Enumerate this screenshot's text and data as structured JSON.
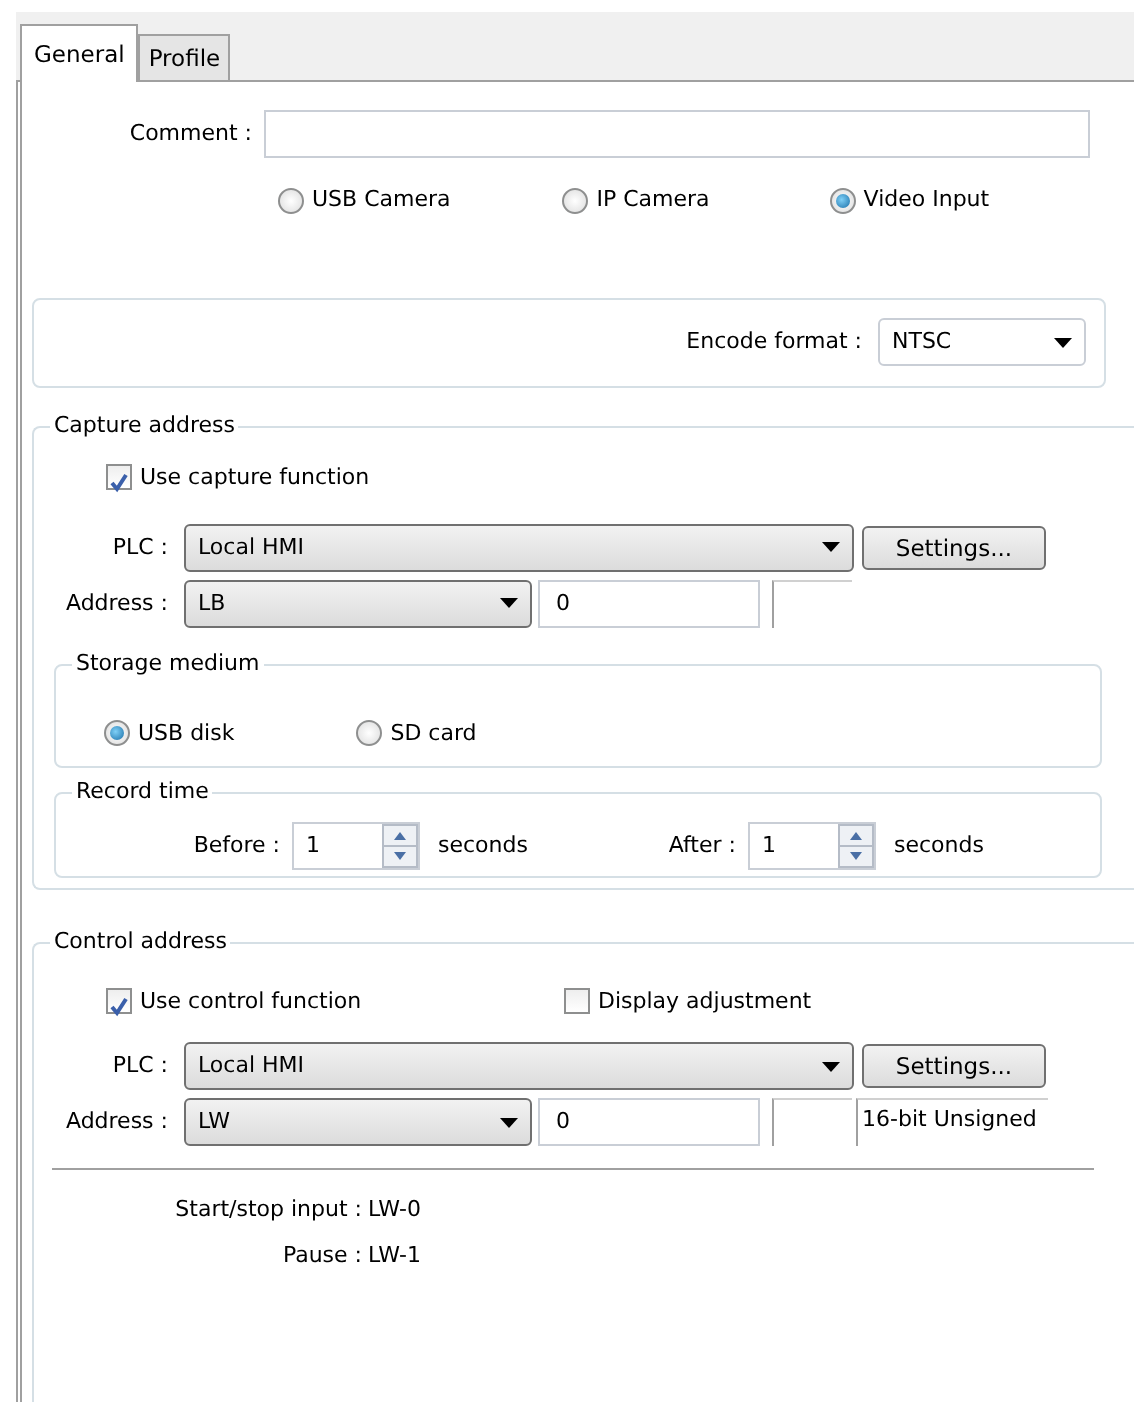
{
  "tabs": [
    {
      "label": "General",
      "selected": true
    },
    {
      "label": "Profile",
      "selected": false
    }
  ],
  "comment": {
    "label": "Comment :"
  },
  "source_options": [
    {
      "label": "USB Camera",
      "selected": false
    },
    {
      "label": "IP Camera",
      "selected": false
    },
    {
      "label": "Video Input",
      "selected": true
    }
  ],
  "encode_format": {
    "label": "Encode format :",
    "value": "NTSC"
  },
  "capture_address": {
    "title": "Capture address",
    "checkboxes": [
      {
        "label": "Use capture function",
        "checked": true
      }
    ],
    "plc": {
      "label": "PLC :",
      "value": "Local HMI",
      "button": "Settings..."
    },
    "address": {
      "label": "Address :",
      "device": "LB",
      "value": "0"
    },
    "storage_medium": {
      "title": "Storage medium",
      "options": [
        {
          "label": "USB disk",
          "selected": true
        },
        {
          "label": "SD card",
          "selected": false
        }
      ]
    },
    "record_time": {
      "title": "Record time",
      "fields": [
        {
          "label": "Before :",
          "value": "1",
          "unit": "seconds"
        },
        {
          "label": "After :",
          "value": "1",
          "unit": "seconds"
        }
      ]
    }
  },
  "control_address": {
    "title": "Control address",
    "checkboxes": [
      {
        "label": "Use control function",
        "checked": true
      },
      {
        "label": "Display adjustment",
        "checked": false
      }
    ],
    "plc": {
      "label": "PLC :",
      "value": "Local HMI",
      "button": "Settings..."
    },
    "address": {
      "label": "Address :",
      "device": "LW",
      "value": "0",
      "data_type": "16-bit Unsigned"
    },
    "info": [
      {
        "label": "Start/stop input :",
        "value": "LW-0"
      },
      {
        "label": "Pause :",
        "value": "LW-1"
      }
    ]
  }
}
